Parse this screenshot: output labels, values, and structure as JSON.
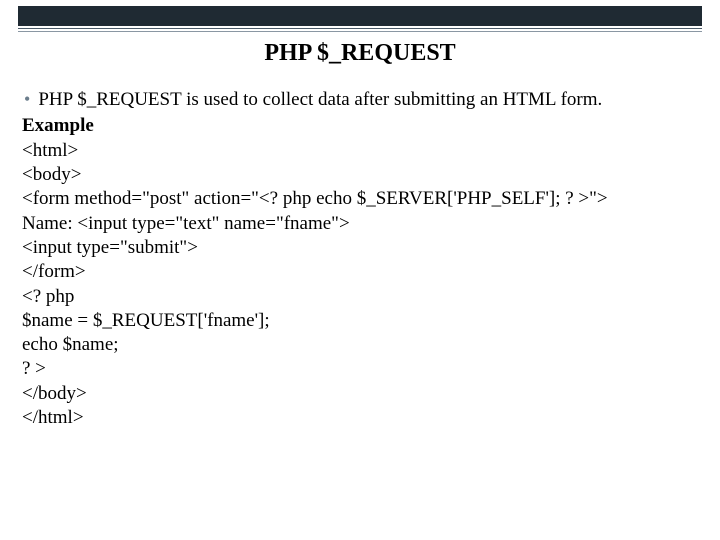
{
  "title": "PHP $_REQUEST",
  "bullet": "PHP $_REQUEST is used to collect data after submitting an HTML form.",
  "example_label": "Example",
  "code": [
    "<html>",
    "<body>",
    "<form method=\"post\" action=\"<? php echo $_SERVER['PHP_SELF']; ? >\">",
    "Name: <input type=\"text\" name=\"fname\">",
    "<input type=\"submit\">",
    "</form>",
    "<? php",
    "$name = $_REQUEST['fname'];",
    "echo $name;",
    "? >",
    "</body>",
    "</html>"
  ]
}
